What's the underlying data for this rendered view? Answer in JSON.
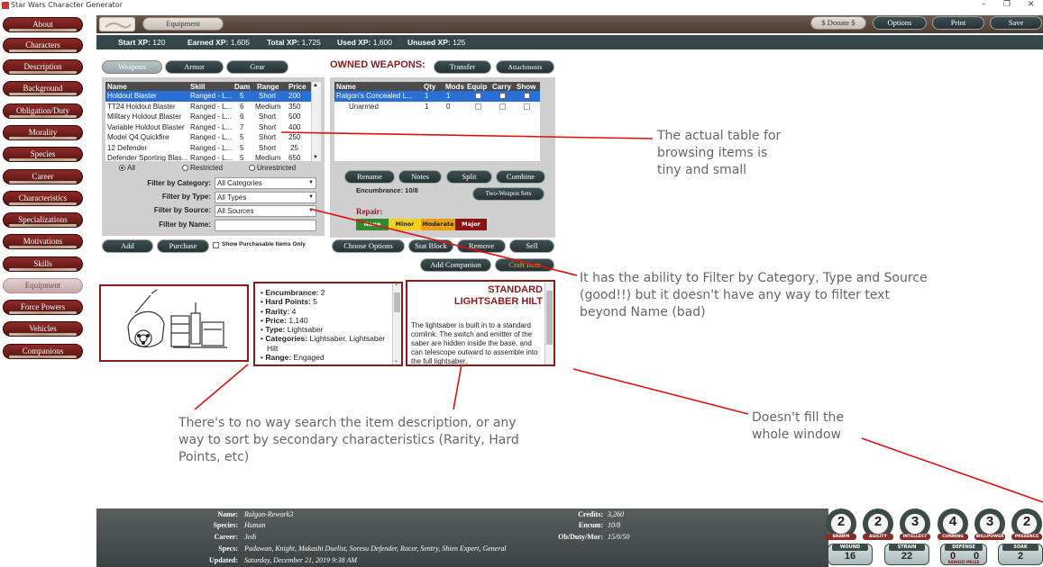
{
  "window": {
    "title": "Star Wars Character Generator",
    "controls": [
      "–",
      "❐",
      "✕"
    ]
  },
  "header": {
    "section_title": "Equipment",
    "buttons": {
      "donate": "$ Donate $",
      "options": "Options",
      "print": "Print",
      "save": "Save"
    }
  },
  "xp": {
    "start_label": "Start XP:",
    "start_value": "120",
    "earned_label": "Earned XP:",
    "earned_value": "1,605",
    "total_label": "Total XP:",
    "total_value": "1,725",
    "used_label": "Used XP:",
    "used_value": "1,600",
    "unused_label": "Unused XP:",
    "unused_value": "125"
  },
  "sidebar": {
    "items": [
      {
        "label": "About"
      },
      {
        "label": "Characters"
      },
      {
        "label": "Description"
      },
      {
        "label": "Background"
      },
      {
        "label": "Obligation/Duty"
      },
      {
        "label": "Morality"
      },
      {
        "label": "Species"
      },
      {
        "label": "Career"
      },
      {
        "label": "Characteristics"
      },
      {
        "label": "Specializations"
      },
      {
        "label": "Motivations"
      },
      {
        "label": "Skills"
      },
      {
        "label": "Equipment"
      },
      {
        "label": "Force Powers"
      },
      {
        "label": "Vehicles"
      },
      {
        "label": "Companions"
      }
    ],
    "active": "Equipment"
  },
  "tabs": {
    "weapons": "Weapons",
    "armor": "Armor",
    "gear": "Gear"
  },
  "items_table": {
    "columns": [
      "Name",
      "Skill",
      "Dam",
      "Range",
      "Price"
    ],
    "rows": [
      [
        "Holdout Blaster",
        "Ranged - L...",
        "5",
        "Short",
        "200"
      ],
      [
        "TT24 Holdout Blaster",
        "Ranged - L...",
        "6",
        "Medium",
        "350"
      ],
      [
        "Military Holdout Blaster",
        "Ranged - L...",
        "6",
        "Short",
        "500"
      ],
      [
        "Variable Holdout Blaster",
        "Ranged - L...",
        "7",
        "Short",
        "400"
      ],
      [
        "Model Q4 Quickfire",
        "Ranged - L...",
        "5",
        "Short",
        "250"
      ],
      [
        "12 Defender",
        "Ranged - L...",
        "5",
        "Short",
        "25"
      ],
      [
        "Defender Sporting Blas...",
        "Ranged - L...",
        "5",
        "Medium",
        "650"
      ]
    ],
    "selected_row": 0
  },
  "availability": {
    "all": "All",
    "restricted": "Restricted",
    "unrestricted": "Unrestricted"
  },
  "filters": {
    "category_label": "Filter by Category:",
    "category_value": "All Categories",
    "type_label": "Filter by Type:",
    "type_value": "All Types",
    "source_label": "Filter by Source:",
    "source_value": "All Sources",
    "name_label": "Filter by Name:",
    "name_value": ""
  },
  "left_actions": {
    "add": "Add",
    "purchase": "Purchase",
    "show_purchasable": "Show Purchasable Items Only"
  },
  "owned": {
    "title": "OWNED WEAPONS:",
    "transfer": "Transfer",
    "attachments": "Attachments",
    "columns": [
      "Name",
      "Qty",
      "Mods",
      "Equip",
      "Carry",
      "Show"
    ],
    "rows": [
      {
        "name": "Ralgon's Concealed L...",
        "qty": "1",
        "mods": "1"
      },
      {
        "name": "Unarmed",
        "qty": "1",
        "mods": "0"
      }
    ],
    "rename": "Rename",
    "notes": "Notes",
    "split": "Split",
    "combine": "Combine",
    "encumbrance": "Encumbrance: 10/8",
    "two_weapon": "Two-Weapon Sets",
    "repair_label": "Repair:",
    "repair_levels": [
      "None",
      "Minor",
      "Moderate",
      "Major"
    ],
    "repair_colors": [
      "#2f8a2f",
      "#f2d01c",
      "#e8a010",
      "#8b1010"
    ]
  },
  "right_actions": {
    "choose_options": "Choose Options",
    "stat_block": "Stat Block",
    "remove": "Remove",
    "sell": "Sell",
    "add_companion": "Add Companion",
    "craft_item": "Craft Item"
  },
  "item_stats": [
    {
      "label": "Encumbrance:",
      "value": "2"
    },
    {
      "label": "Hard Points:",
      "value": "5"
    },
    {
      "label": "Rarity:",
      "value": "4"
    },
    {
      "label": "Price:",
      "value": "1,140"
    },
    {
      "label": "Type:",
      "value": "Lightsaber"
    },
    {
      "label": "Categories:",
      "value": "Lightsaber, Lightsaber Hilt"
    },
    {
      "label": "Range:",
      "value": "Engaged"
    }
  ],
  "description": {
    "title_line1": "STANDARD",
    "title_line2": "LIGHTSABER HILT",
    "text": "The lightsaber is built in to a standard comlink. The switch and emitter of the saber are hidden inside the base, and can telescope outward to assemble into the full lightsaber."
  },
  "annotations": {
    "tiny_table": "The actual table for browsing items is tiny and small",
    "filters": "It has the ability to Filter by Category, Type and Source (good!!) but it doesn't have any way to filter text beyond Name (bad)",
    "search": "There's  to no way search the item description, or any way to sort by secondary characteristics (Rarity, Hard Points, etc)",
    "window": "Doesn't fill the whole window"
  },
  "character": {
    "name_label": "Name:",
    "name": "Ralgon-Rework3",
    "species_label": "Species:",
    "species": "Human",
    "career_label": "Career:",
    "career": "Jedi",
    "specs_label": "Specs:",
    "specs": "Padawan, Knight, Makashi Duelist, Soresu Defender, Racer, Sentry, Shien Expert, General",
    "updated_label": "Updated:",
    "updated": "Saturday, December 21, 2019 9:38 AM",
    "credits_label": "Credits:",
    "credits": "3,260",
    "encum_label": "Encum:",
    "encum": "10/8",
    "obduty_label": "Ob/Duty/Mor:",
    "obduty": "15/0/50"
  },
  "characteristics": [
    {
      "label": "BRAWN",
      "value": "2"
    },
    {
      "label": "AGILITY",
      "value": "2"
    },
    {
      "label": "INTELLECT",
      "value": "3"
    },
    {
      "label": "CUNNING",
      "value": "4"
    },
    {
      "label": "WILLPOWER",
      "value": "3"
    },
    {
      "label": "PRESENCE",
      "value": "2"
    }
  ],
  "derived": {
    "wound_label": "WOUND",
    "wound": "16",
    "strain_label": "STRAIN",
    "strain": "22",
    "defense_label": "DEFENSE",
    "defense_ranged": "0",
    "defense_melee": "0",
    "defense_sub": "RANGED MELEE",
    "soak_label": "SOAK",
    "soak": "2"
  },
  "colors": {
    "sidebar": "#6e1d1a",
    "header": "#5a4a40",
    "xpbar": "#33464a",
    "annotation_line": "#e01010",
    "selected_row": "#2a6fd6"
  }
}
